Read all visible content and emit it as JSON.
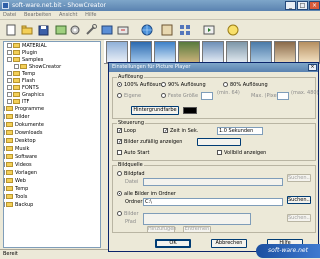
{
  "window": {
    "title": "soft-ware.net.bit - ShowCreator",
    "minimize": "_",
    "maximize": "□",
    "close": "×"
  },
  "menu": [
    "Datei",
    "Bearbeiten",
    "Ansicht",
    "Hilfe"
  ],
  "tree": [
    {
      "label": "MATERIAL",
      "indent": 2,
      "type": "folder"
    },
    {
      "label": "Plugin",
      "indent": 2,
      "type": "folder"
    },
    {
      "label": "Samples",
      "indent": 2,
      "type": "folder"
    },
    {
      "label": "ShowCreator",
      "indent": 3,
      "type": "folder"
    },
    {
      "label": "Temp",
      "indent": 2,
      "type": "folder"
    },
    {
      "label": "Flash",
      "indent": 2,
      "type": "folder"
    },
    {
      "label": "FONTS",
      "indent": 2,
      "type": "folder"
    },
    {
      "label": "Graphics",
      "indent": 2,
      "type": "folder"
    },
    {
      "label": "ITF",
      "indent": 2,
      "type": "folder"
    },
    {
      "label": "Programme",
      "indent": 1,
      "type": "folder"
    },
    {
      "label": "Bilder",
      "indent": 1,
      "type": "folder"
    },
    {
      "label": "Dokumente",
      "indent": 1,
      "type": "folder"
    },
    {
      "label": "Downloads",
      "indent": 1,
      "type": "folder"
    },
    {
      "label": "Desktop",
      "indent": 1,
      "type": "folder"
    },
    {
      "label": "Musik",
      "indent": 1,
      "type": "folder"
    },
    {
      "label": "Software",
      "indent": 1,
      "type": "folder"
    },
    {
      "label": "Videos",
      "indent": 1,
      "type": "folder"
    },
    {
      "label": "Vorlagen",
      "indent": 1,
      "type": "folder"
    },
    {
      "label": "Web",
      "indent": 1,
      "type": "folder"
    },
    {
      "label": "Temp",
      "indent": 1,
      "type": "folder"
    },
    {
      "label": "Tools",
      "indent": 1,
      "type": "folder"
    },
    {
      "label": "Backup",
      "indent": 1,
      "type": "folder"
    }
  ],
  "status": "Bereit",
  "watermark": "soft-ware.net",
  "dialog": {
    "title": "Einstellungen für Picture Player",
    "close": "×",
    "aufloesung": {
      "group": "Auflösung",
      "r100": "100% Auflösung",
      "r90": "90% Auflösung",
      "r80": "80% Auflösung",
      "custom": "Eigene",
      "fixed": "Feste Größe",
      "min_value": "(min. 64)",
      "max_label": "Max. (Pixel)",
      "max_value": "(max. 480)",
      "color_button": "Hintergrundfarbe"
    },
    "steuerung": {
      "group": "Steuerung",
      "loop": "Loop",
      "wait": "Zeit in Sek.",
      "wait_value": "1.0 Sekunden",
      "shuffle": "Bilder zufällig anzeigen",
      "autostart": "Auto Start",
      "fullscreen": "Vollbild anzeigen"
    },
    "bildquelle": {
      "group": "Bildquelle",
      "radio1": "Bildpfad",
      "label1": "Datei",
      "radio2": "alle Bilder im Ordner",
      "label2": "Ordner",
      "value2": "C:\\",
      "radio3": "Bilder",
      "label3": "Pfad",
      "browse": "Suchen...",
      "add": "Hinzufügen",
      "remove": "Entfernen"
    },
    "buttons": {
      "ok": "OK",
      "cancel": "Abbrechen",
      "help": "Hilfe"
    }
  },
  "colors": {
    "titlebar": "#5a82b0",
    "dialog_bg": "#ece9d8",
    "swatch": "#000000"
  }
}
